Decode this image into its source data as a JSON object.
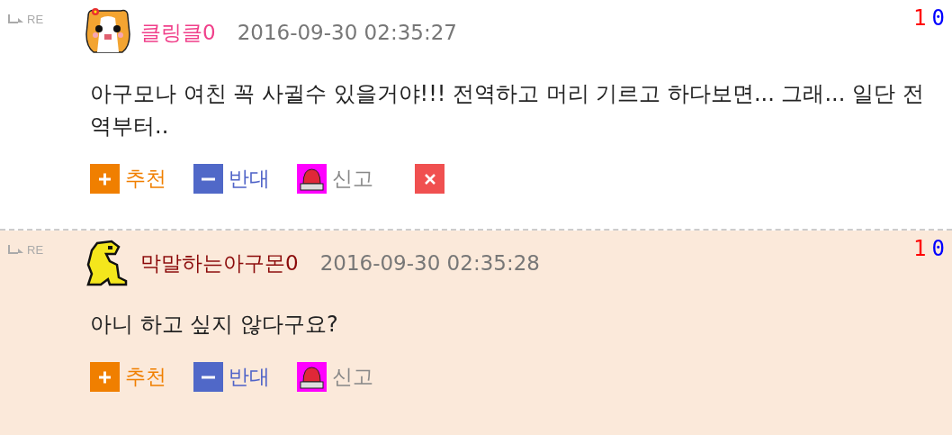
{
  "comments": [
    {
      "reply_label": "RE",
      "author": "클링클0",
      "color": "#f0408a",
      "time": "2016-09-30 02:35:27",
      "up_count": "1",
      "down_count": "0",
      "highlighted": false,
      "avatar": {
        "kind": "hamster"
      },
      "body": "아구모나 여친 꼭 사귈수 있을거야!!! 전역하고 머리 기르고 하다보면... 그래... 일단 전역부터..",
      "actions": [
        {
          "kind": "recommend",
          "label": "추천"
        },
        {
          "kind": "oppose",
          "label": "반대"
        },
        {
          "kind": "report",
          "label": "신고"
        },
        {
          "kind": "delete"
        }
      ]
    },
    {
      "reply_label": "RE",
      "author": "막말하는아구몬0",
      "color": "#8b0a0a",
      "time": "2016-09-30 02:35:28",
      "up_count": "1",
      "down_count": "0",
      "highlighted": true,
      "avatar": {
        "kind": "dino"
      },
      "body": "아니 하고 싶지 않다구요?",
      "actions": [
        {
          "kind": "recommend",
          "label": "추천"
        },
        {
          "kind": "oppose",
          "label": "반대"
        },
        {
          "kind": "report",
          "label": "신고"
        }
      ]
    }
  ]
}
